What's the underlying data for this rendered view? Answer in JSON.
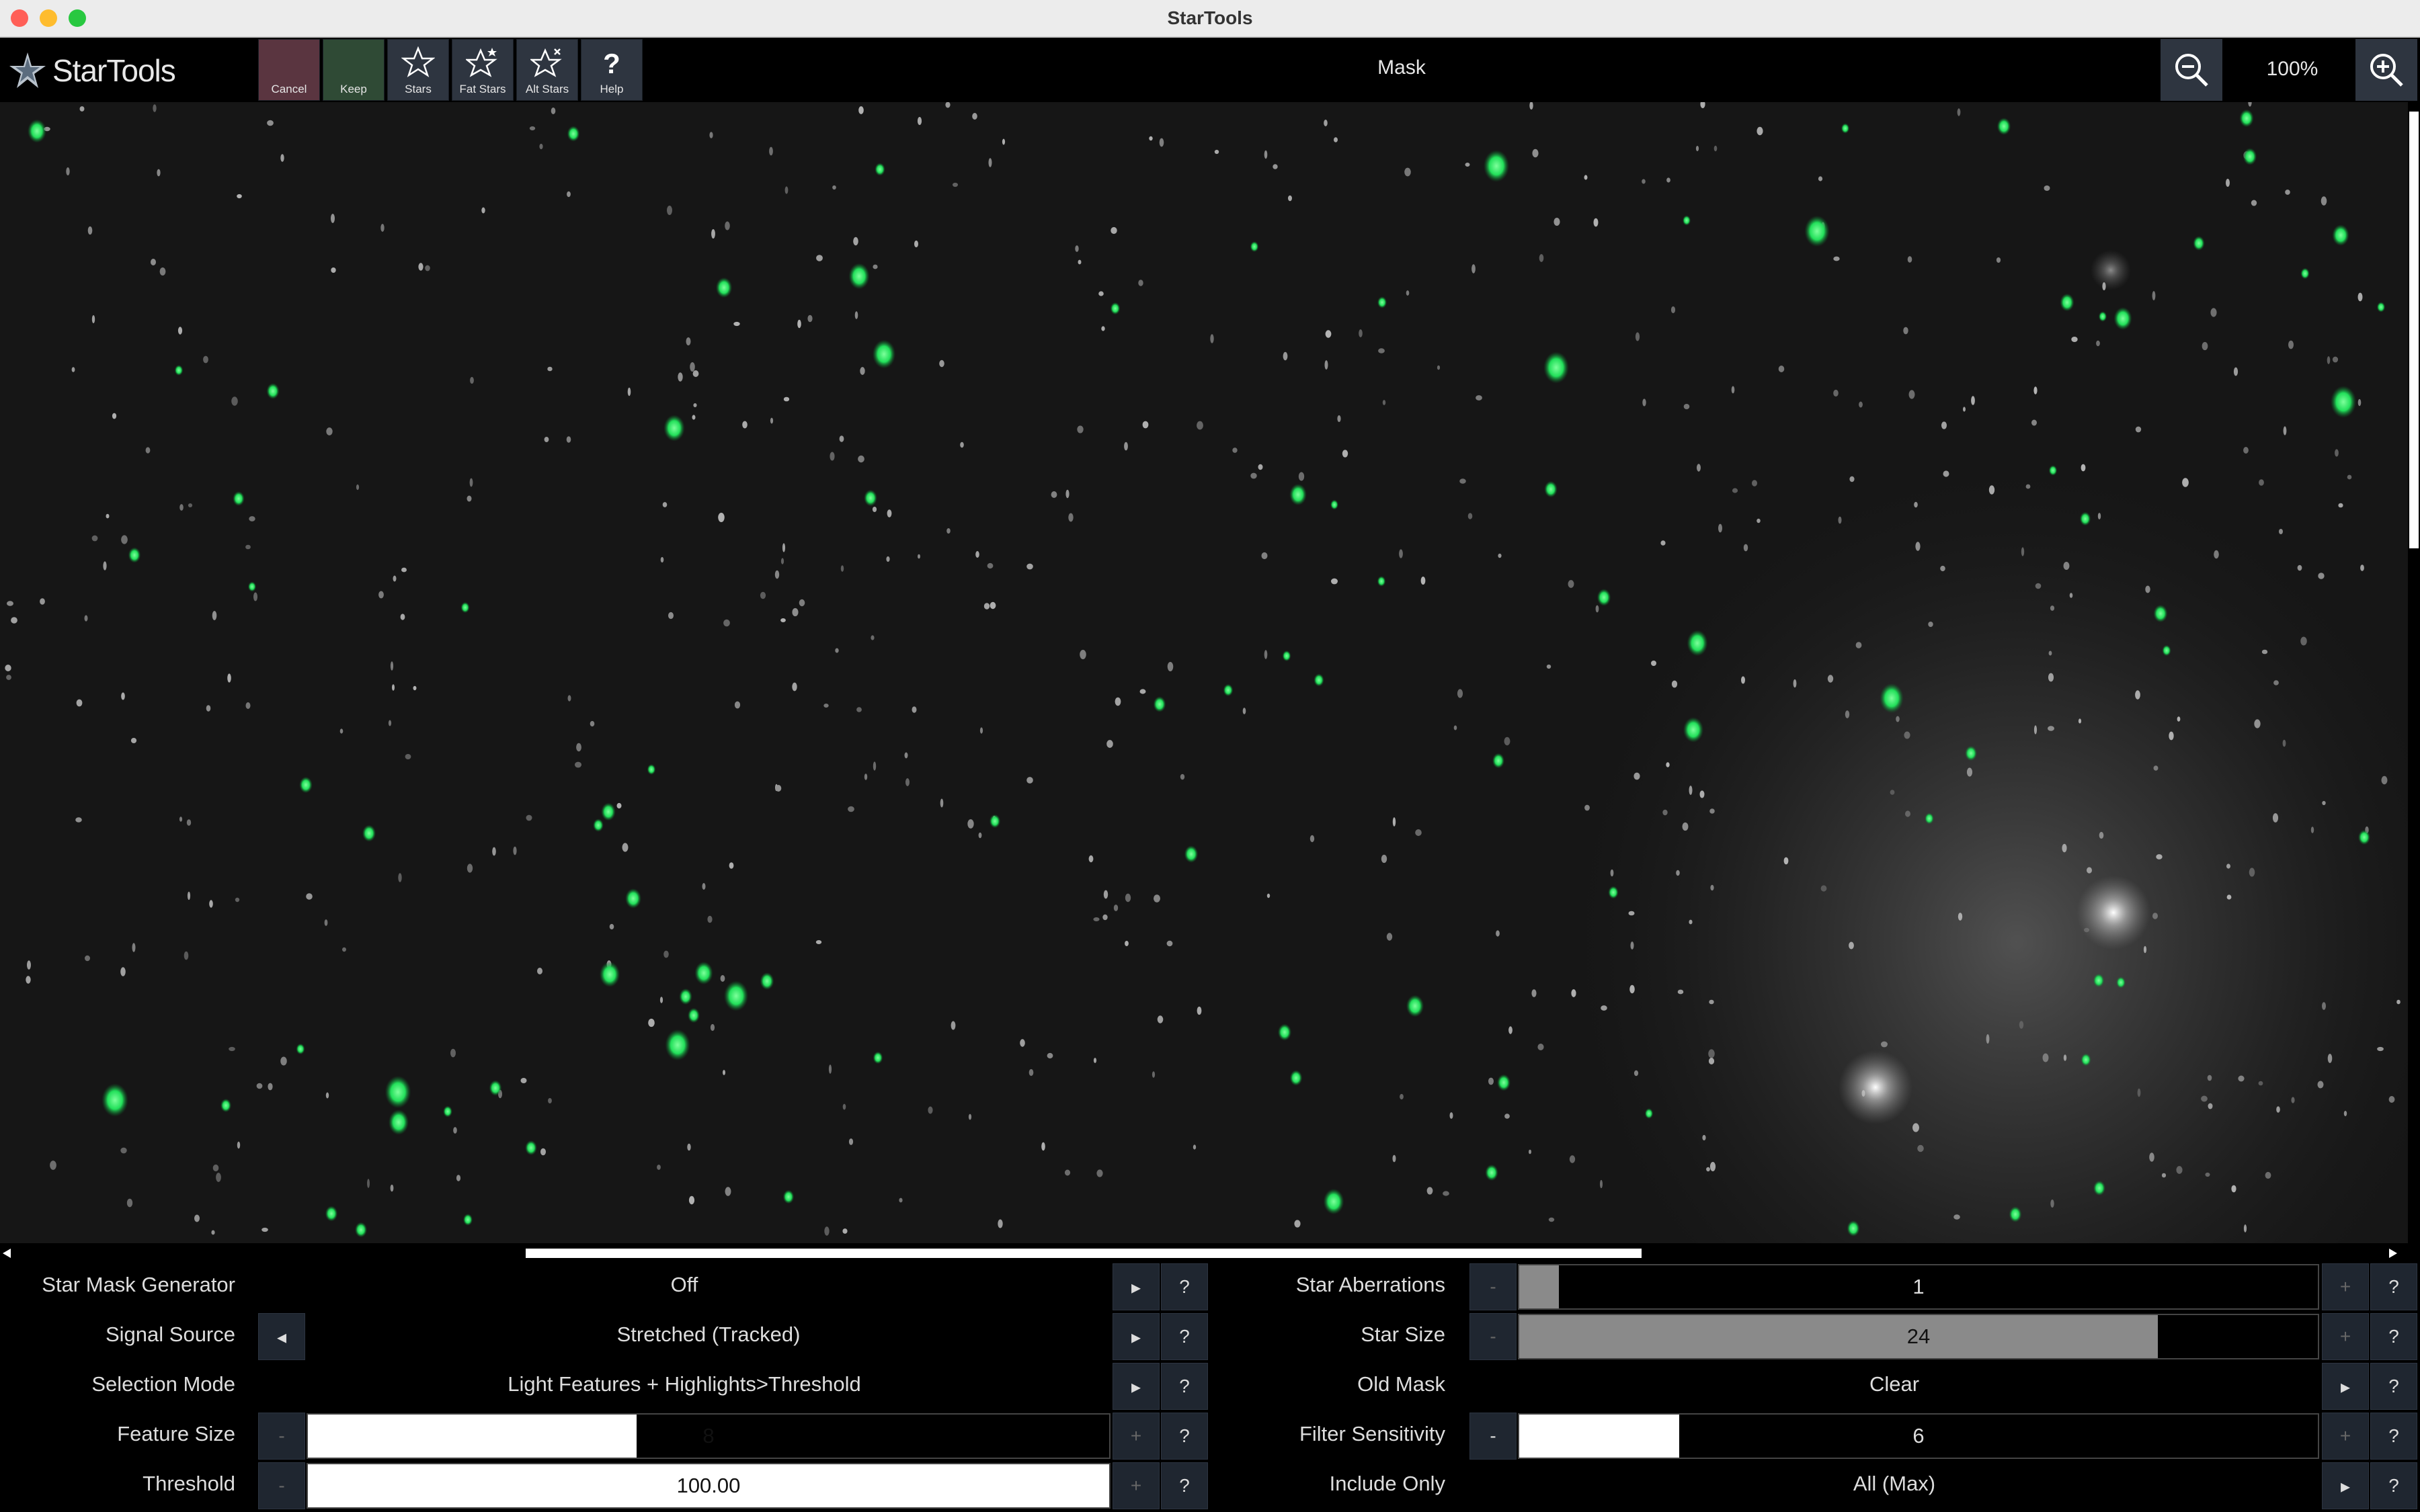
{
  "window": {
    "title": "StarTools",
    "colors": {
      "close": "#ff5f57",
      "minimize": "#febc2e",
      "maximize": "#28c840"
    }
  },
  "toolbar": {
    "logo": "StarTools",
    "buttons": [
      {
        "label": "Cancel",
        "icon": "cancel-blank",
        "color": "#5a3540"
      },
      {
        "label": "Keep",
        "icon": "keep-blank",
        "color": "#2f4a35"
      },
      {
        "label": "Stars",
        "icon": "star-outline-icon",
        "color": "#2e3540"
      },
      {
        "label": "Fat Stars",
        "icon": "fat-star-icon",
        "color": "#2e3540"
      },
      {
        "label": "Alt Stars",
        "icon": "alt-star-icon",
        "color": "#2e3540"
      },
      {
        "label": "Help",
        "icon": "question-mark-icon",
        "color": "#2e3540"
      }
    ],
    "mode_title": "Mask",
    "zoom_out_icon": "zoom-out-icon",
    "zoom_in_icon": "zoom-in-icon",
    "zoom_level": "100%"
  },
  "viewport": {
    "description_colors": {
      "background": "#161616",
      "mask_star": "#22e05a"
    }
  },
  "params_left": [
    {
      "label": "Star Mask Generator",
      "value": "Off"
    },
    {
      "label": "Signal Source",
      "value": "Stretched (Tracked)"
    },
    {
      "label": "Selection Mode",
      "value": "Light Features + Highlights>Threshold"
    },
    {
      "label": "Feature Size",
      "value": "8",
      "fill_fraction": 0.41
    },
    {
      "label": "Threshold",
      "value": "100.00",
      "fill_fraction": 1.0
    }
  ],
  "params_right": [
    {
      "label": "Star Aberrations",
      "value": "1",
      "fill_fraction": 0.05
    },
    {
      "label": "Star Size",
      "value": "24",
      "fill_fraction": 0.8
    },
    {
      "label": "Old Mask",
      "value": "Clear"
    },
    {
      "label": "Filter Sensitivity",
      "value": "6",
      "fill_fraction": 0.2
    },
    {
      "label": "Include Only",
      "value": "All (Max)"
    }
  ],
  "controls": {
    "minus": "-",
    "plus": "+",
    "help": "?",
    "next": "▸",
    "prev": "◂"
  }
}
